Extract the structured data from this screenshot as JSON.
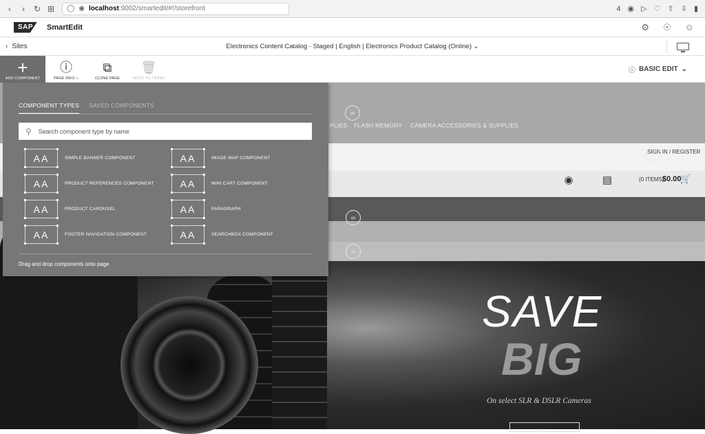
{
  "browser": {
    "url_host": "localhost",
    "url_path": ":9002/smartedit/#!/storefront",
    "badge": "4"
  },
  "header": {
    "logo_text": "SAP",
    "app_title": "SmartEdit"
  },
  "sitesbar": {
    "sites_label": "Sites",
    "catalog_text": "Electronics Content Catalog - Staged | English | Electronics Product Catalog (Online)"
  },
  "toolbar": {
    "items": [
      {
        "label": "ADD COMPONENT",
        "icon": "plus-icon"
      },
      {
        "label": "PAGE INFO",
        "icon": "info-icon"
      },
      {
        "label": "CLONE PAGE",
        "icon": "clone-icon"
      },
      {
        "label": "MOVE TO TRASH",
        "icon": "trash-icon"
      }
    ],
    "mode_label": "BASIC EDIT"
  },
  "component_menu": {
    "tabs": [
      "COMPONENT TYPES",
      "SAVED COMPONENTS"
    ],
    "search_placeholder": "Search component type by name",
    "icon_text": "AA",
    "components_left": [
      "SIMPLE BANNER COMPONENT",
      "PRODUCT REFERENCES COMPONENT",
      "PRODUCT CAROUSEL",
      "FOOTER NAVIGATION COMPONENT"
    ],
    "components_right": [
      "IMAGE MAP COMPONENT",
      "MINI CART COMPONENT",
      "PARAGRAPH",
      "SEARCHBOX COMPONENT"
    ],
    "footer": "Drag and drop components onto page"
  },
  "storefront": {
    "sign_in": "SIGN IN / REGISTER",
    "nav_items": [
      "PLIES",
      "FLASH MEMORY",
      "CAMERA ACCESSORIES & SUPPLIES"
    ],
    "cart_items": "(0 ITEMS)",
    "cart_total": "$0.00",
    "hero_line1": "SAVE",
    "hero_line2": "BIG",
    "hero_line3": "On select SLR & DSLR Cameras"
  }
}
